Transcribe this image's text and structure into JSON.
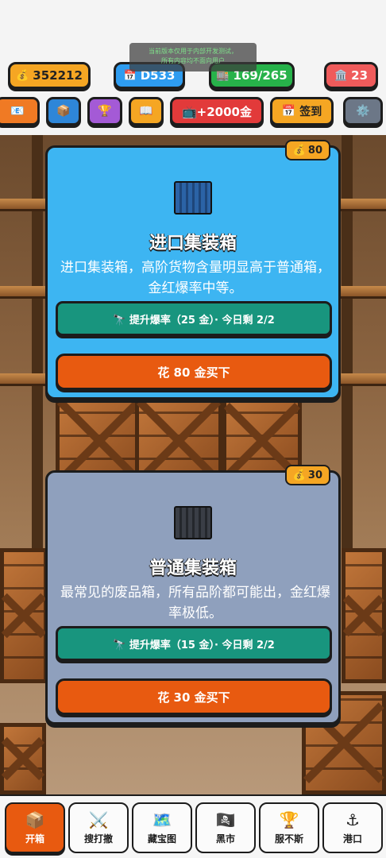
{
  "notice": {
    "line1": "当前版本仅用于内部开发测试，",
    "line2": "所有内容均不面向用户"
  },
  "stats": {
    "coins": "352212",
    "day": "D533",
    "stock": "169/265",
    "bank": "23"
  },
  "toolbar": {
    "ad_label": "📺+2000金",
    "sign_label": "签到"
  },
  "cards": [
    {
      "price": "80",
      "title": "进口集装箱",
      "desc": "进口集装箱，高阶货物含量明显高于普通箱，金红爆率中等。",
      "boost_label": "🔭 提升爆率（25 金）· 今日剩 2/2",
      "buy_label": "花 80 金买下",
      "color": "#3db5f2"
    },
    {
      "price": "30",
      "title": "普通集装箱",
      "desc": "最常见的废品箱，所有品阶都可能出，金红爆率极低。",
      "boost_label": "🔭 提升爆率（15 金）· 今日剩 2/2",
      "buy_label": "花 30 金买下",
      "color": "#8fa0bd"
    }
  ],
  "nav": [
    {
      "label": "开箱",
      "icon": "crate-icon",
      "active": true
    },
    {
      "label": "搜打撤",
      "icon": "swords-icon",
      "active": false
    },
    {
      "label": "藏宝图",
      "icon": "map-icon",
      "active": false
    },
    {
      "label": "黑市",
      "icon": "pirate-flag-icon",
      "active": false
    },
    {
      "label": "服不斯",
      "icon": "trophy-icon",
      "active": false
    },
    {
      "label": "港口",
      "icon": "anchor-icon",
      "active": false
    }
  ],
  "colors": {
    "accent_orange": "#e85a10",
    "teal": "#18957e",
    "gold": "#f5a623"
  }
}
